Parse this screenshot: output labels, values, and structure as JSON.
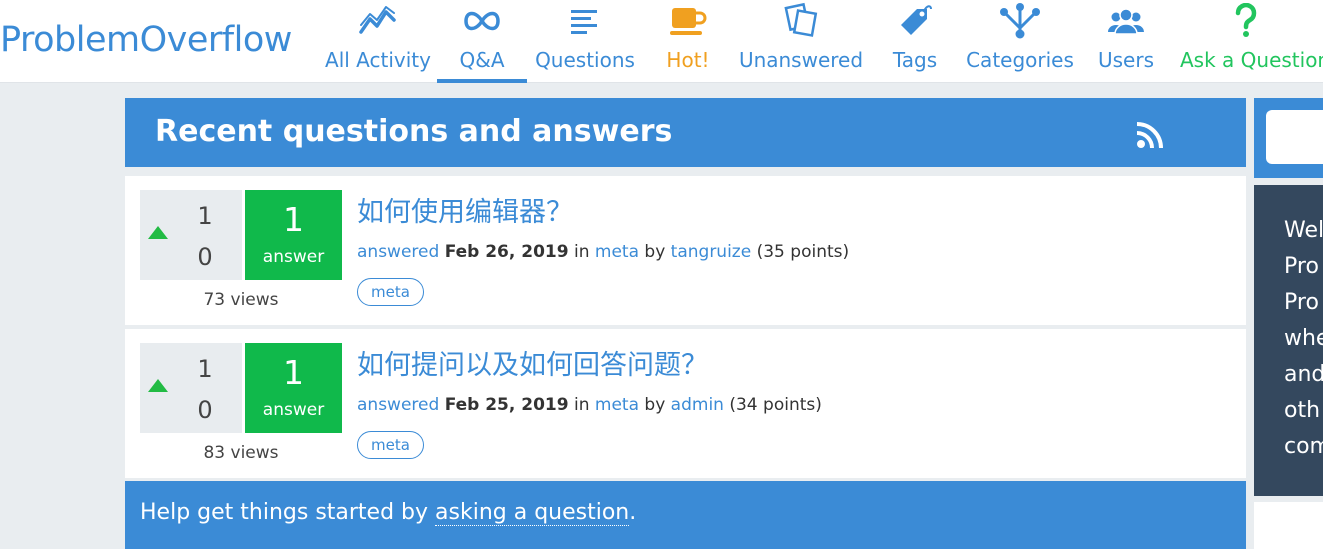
{
  "header": {
    "logo": "ProblemOverflow",
    "nav": [
      {
        "label": "All Activity",
        "icon": "activity-chart-icon"
      },
      {
        "label": "Q&A",
        "icon": "infinity-icon",
        "active": true
      },
      {
        "label": "Questions",
        "icon": "list-lines-icon"
      },
      {
        "label": "Hot!",
        "icon": "coffee-cup-icon"
      },
      {
        "label": "Unanswered",
        "icon": "cards-icon"
      },
      {
        "label": "Tags",
        "icon": "tag-icon"
      },
      {
        "label": "Categories",
        "icon": "hierarchy-icon"
      },
      {
        "label": "Users",
        "icon": "users-icon"
      },
      {
        "label": "Ask a Question",
        "icon": "question-mark-icon"
      }
    ]
  },
  "main": {
    "title": "Recent questions and answers",
    "rss_icon": "rss-icon",
    "questions": [
      {
        "net_votes": "1",
        "votes_down": "0",
        "answers": "1",
        "answers_label": "answer",
        "views": "73 views",
        "title": "如何使用编辑器？",
        "action": "answered",
        "date": "Feb 26, 2019",
        "in": "in",
        "category": "meta",
        "by": "by",
        "user": "tangruize",
        "points": "(35 points)",
        "tag": "meta"
      },
      {
        "net_votes": "1",
        "votes_down": "0",
        "answers": "1",
        "answers_label": "answer",
        "views": "83 views",
        "title": "如何提问以及如何回答问题？",
        "action": "answered",
        "date": "Feb 25, 2019",
        "in": "in",
        "category": "meta",
        "by": "by",
        "user": "admin",
        "points": "(34 points)",
        "tag": "meta"
      }
    ],
    "help": {
      "prefix": "Help get things started by ",
      "link": "asking a question",
      "suffix": "."
    }
  },
  "sidebar": {
    "welcome_lines": [
      "Wel",
      "Pro",
      "Pro",
      "whe",
      "and",
      "oth",
      "com"
    ]
  },
  "colors": {
    "brand": "#3b8bd6",
    "answer_green": "#10b94b",
    "hot": "#f0a020",
    "ask": "#22c55e",
    "sidebar_dark": "#34485e"
  }
}
